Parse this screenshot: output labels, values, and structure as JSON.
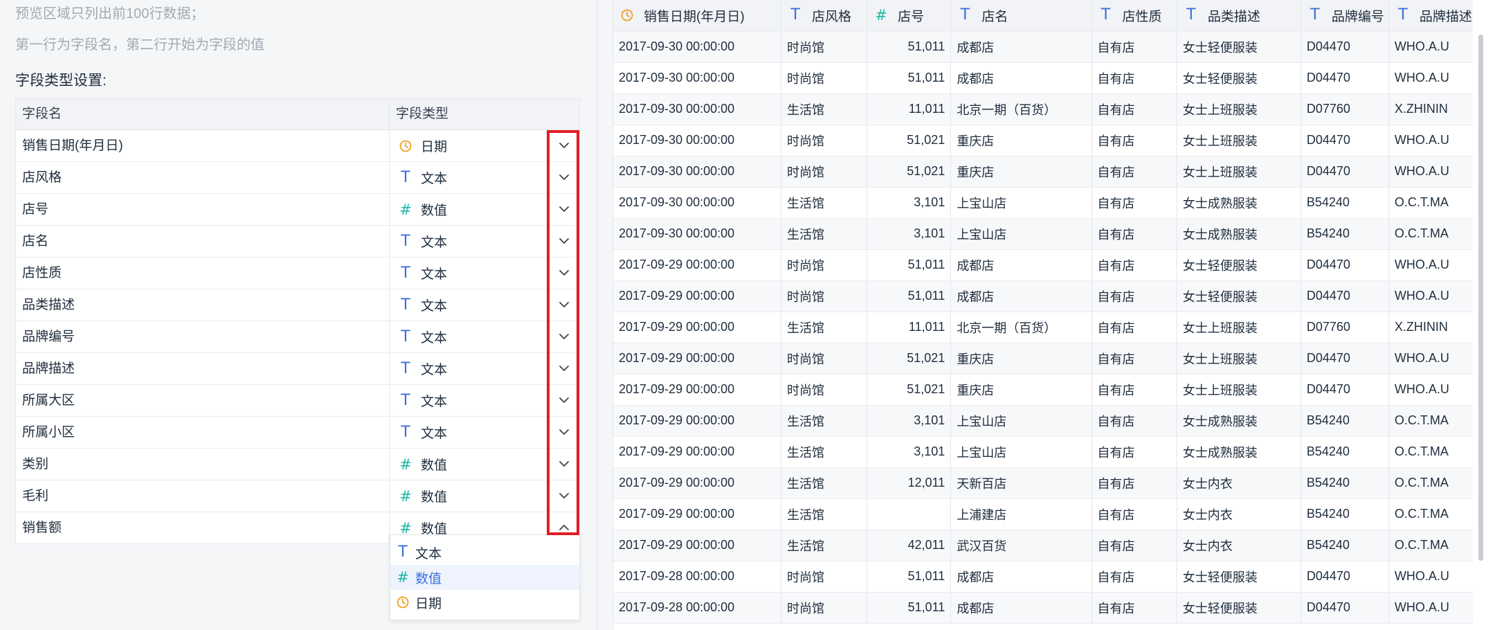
{
  "hints": {
    "line1": "预览区域只列出前100行数据；",
    "line2": "第一行为字段名，第二行开始为字段的值"
  },
  "section_title": "字段类型设置:",
  "field_table": {
    "headers": [
      "字段名",
      "字段类型"
    ],
    "rows": [
      {
        "name": "销售日期(年月日)",
        "type": "日期",
        "icon": "clock-icon",
        "chevron": "chevron-down-icon"
      },
      {
        "name": "店风格",
        "type": "文本",
        "icon": "text-type-icon",
        "chevron": "chevron-down-icon"
      },
      {
        "name": "店号",
        "type": "数值",
        "icon": "number-type-icon",
        "chevron": "chevron-down-icon"
      },
      {
        "name": "店名",
        "type": "文本",
        "icon": "text-type-icon",
        "chevron": "chevron-down-icon"
      },
      {
        "name": "店性质",
        "type": "文本",
        "icon": "text-type-icon",
        "chevron": "chevron-down-icon"
      },
      {
        "name": "品类描述",
        "type": "文本",
        "icon": "text-type-icon",
        "chevron": "chevron-down-icon"
      },
      {
        "name": "品牌编号",
        "type": "文本",
        "icon": "text-type-icon",
        "chevron": "chevron-down-icon"
      },
      {
        "name": "品牌描述",
        "type": "文本",
        "icon": "text-type-icon",
        "chevron": "chevron-down-icon"
      },
      {
        "name": "所属大区",
        "type": "文本",
        "icon": "text-type-icon",
        "chevron": "chevron-down-icon"
      },
      {
        "name": "所属小区",
        "type": "文本",
        "icon": "text-type-icon",
        "chevron": "chevron-down-icon"
      },
      {
        "name": "类别",
        "type": "数值",
        "icon": "number-type-icon",
        "chevron": "chevron-down-icon"
      },
      {
        "name": "毛利",
        "type": "数值",
        "icon": "number-type-icon",
        "chevron": "chevron-down-icon"
      },
      {
        "name": "销售额",
        "type": "数值",
        "icon": "number-type-icon",
        "chevron": "chevron-up-icon"
      }
    ]
  },
  "dropdown": {
    "options": [
      {
        "label": "文本",
        "icon": "text-type-icon",
        "selected": false
      },
      {
        "label": "数值",
        "icon": "number-type-icon",
        "selected": true
      },
      {
        "label": "日期",
        "icon": "clock-icon",
        "selected": false
      }
    ]
  },
  "colors": {
    "highlight_box": "#e21c26",
    "text_icon": "#3a6fd8",
    "number_icon": "#1fb7a6",
    "date_icon": "#f0a020",
    "selected_option": "#3a6fd8"
  },
  "preview": {
    "columns": [
      {
        "label": "销售日期(年月日)",
        "icon": "clock-icon",
        "align": "left"
      },
      {
        "label": "店风格",
        "icon": "text-type-icon",
        "align": "left"
      },
      {
        "label": "店号",
        "icon": "number-type-icon",
        "align": "right"
      },
      {
        "label": "店名",
        "icon": "text-type-icon",
        "align": "left"
      },
      {
        "label": "店性质",
        "icon": "text-type-icon",
        "align": "left"
      },
      {
        "label": "品类描述",
        "icon": "text-type-icon",
        "align": "left"
      },
      {
        "label": "品牌编号",
        "icon": "text-type-icon",
        "align": "left"
      },
      {
        "label": "品牌描述",
        "icon": "text-type-icon",
        "align": "left"
      }
    ],
    "rows": [
      [
        "2017-09-30 00:00:00",
        "时尚馆",
        "51,011",
        "成都店",
        "自有店",
        "女士轻便服装",
        "D04470",
        "WHO.A.U"
      ],
      [
        "2017-09-30 00:00:00",
        "时尚馆",
        "51,011",
        "成都店",
        "自有店",
        "女士轻便服装",
        "D04470",
        "WHO.A.U"
      ],
      [
        "2017-09-30 00:00:00",
        "生活馆",
        "11,011",
        "北京一期（百货）",
        "自有店",
        "女士上班服装",
        "D07760",
        "X.ZHININ"
      ],
      [
        "2017-09-30 00:00:00",
        "时尚馆",
        "51,021",
        "重庆店",
        "自有店",
        "女士上班服装",
        "D04470",
        "WHO.A.U"
      ],
      [
        "2017-09-30 00:00:00",
        "时尚馆",
        "51,021",
        "重庆店",
        "自有店",
        "女士上班服装",
        "D04470",
        "WHO.A.U"
      ],
      [
        "2017-09-30 00:00:00",
        "生活馆",
        "3,101",
        "上宝山店",
        "自有店",
        "女士成熟服装",
        "B54240",
        "O.C.T.MA"
      ],
      [
        "2017-09-30 00:00:00",
        "生活馆",
        "3,101",
        "上宝山店",
        "自有店",
        "女士成熟服装",
        "B54240",
        "O.C.T.MA"
      ],
      [
        "2017-09-29 00:00:00",
        "时尚馆",
        "51,011",
        "成都店",
        "自有店",
        "女士轻便服装",
        "D04470",
        "WHO.A.U"
      ],
      [
        "2017-09-29 00:00:00",
        "时尚馆",
        "51,011",
        "成都店",
        "自有店",
        "女士轻便服装",
        "D04470",
        "WHO.A.U"
      ],
      [
        "2017-09-29 00:00:00",
        "生活馆",
        "11,011",
        "北京一期（百货）",
        "自有店",
        "女士上班服装",
        "D07760",
        "X.ZHININ"
      ],
      [
        "2017-09-29 00:00:00",
        "时尚馆",
        "51,021",
        "重庆店",
        "自有店",
        "女士上班服装",
        "D04470",
        "WHO.A.U"
      ],
      [
        "2017-09-29 00:00:00",
        "时尚馆",
        "51,021",
        "重庆店",
        "自有店",
        "女士上班服装",
        "D04470",
        "WHO.A.U"
      ],
      [
        "2017-09-29 00:00:00",
        "生活馆",
        "3,101",
        "上宝山店",
        "自有店",
        "女士成熟服装",
        "B54240",
        "O.C.T.MA"
      ],
      [
        "2017-09-29 00:00:00",
        "生活馆",
        "3,101",
        "上宝山店",
        "自有店",
        "女士成熟服装",
        "B54240",
        "O.C.T.MA"
      ],
      [
        "2017-09-29 00:00:00",
        "生活馆",
        "12,011",
        "天新百店",
        "自有店",
        "女士内衣",
        "B54240",
        "O.C.T.MA"
      ],
      [
        "2017-09-29 00:00:00",
        "生活馆",
        "",
        "上浦建店",
        "自有店",
        "女士内衣",
        "B54240",
        "O.C.T.MA"
      ],
      [
        "2017-09-29 00:00:00",
        "生活馆",
        "42,011",
        "武汉百货",
        "自有店",
        "女士内衣",
        "B54240",
        "O.C.T.MA"
      ],
      [
        "2017-09-28 00:00:00",
        "时尚馆",
        "51,011",
        "成都店",
        "自有店",
        "女士轻便服装",
        "D04470",
        "WHO.A.U"
      ],
      [
        "2017-09-28 00:00:00",
        "时尚馆",
        "51,011",
        "成都店",
        "自有店",
        "女士轻便服装",
        "D04470",
        "WHO.A.U"
      ]
    ]
  }
}
